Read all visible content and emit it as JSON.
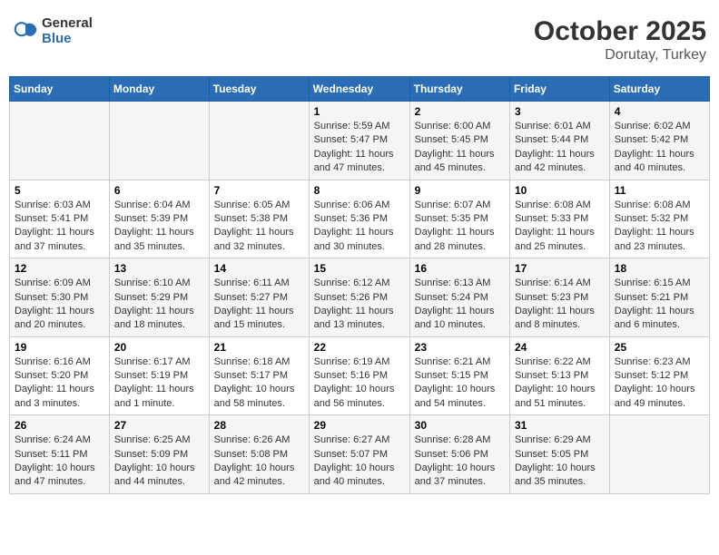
{
  "header": {
    "logo_general": "General",
    "logo_blue": "Blue",
    "month": "October 2025",
    "location": "Dorutay, Turkey"
  },
  "weekdays": [
    "Sunday",
    "Monday",
    "Tuesday",
    "Wednesday",
    "Thursday",
    "Friday",
    "Saturday"
  ],
  "weeks": [
    [
      {
        "day": "",
        "info": ""
      },
      {
        "day": "",
        "info": ""
      },
      {
        "day": "",
        "info": ""
      },
      {
        "day": "1",
        "info": "Sunrise: 5:59 AM\nSunset: 5:47 PM\nDaylight: 11 hours and 47 minutes."
      },
      {
        "day": "2",
        "info": "Sunrise: 6:00 AM\nSunset: 5:45 PM\nDaylight: 11 hours and 45 minutes."
      },
      {
        "day": "3",
        "info": "Sunrise: 6:01 AM\nSunset: 5:44 PM\nDaylight: 11 hours and 42 minutes."
      },
      {
        "day": "4",
        "info": "Sunrise: 6:02 AM\nSunset: 5:42 PM\nDaylight: 11 hours and 40 minutes."
      }
    ],
    [
      {
        "day": "5",
        "info": "Sunrise: 6:03 AM\nSunset: 5:41 PM\nDaylight: 11 hours and 37 minutes."
      },
      {
        "day": "6",
        "info": "Sunrise: 6:04 AM\nSunset: 5:39 PM\nDaylight: 11 hours and 35 minutes."
      },
      {
        "day": "7",
        "info": "Sunrise: 6:05 AM\nSunset: 5:38 PM\nDaylight: 11 hours and 32 minutes."
      },
      {
        "day": "8",
        "info": "Sunrise: 6:06 AM\nSunset: 5:36 PM\nDaylight: 11 hours and 30 minutes."
      },
      {
        "day": "9",
        "info": "Sunrise: 6:07 AM\nSunset: 5:35 PM\nDaylight: 11 hours and 28 minutes."
      },
      {
        "day": "10",
        "info": "Sunrise: 6:08 AM\nSunset: 5:33 PM\nDaylight: 11 hours and 25 minutes."
      },
      {
        "day": "11",
        "info": "Sunrise: 6:08 AM\nSunset: 5:32 PM\nDaylight: 11 hours and 23 minutes."
      }
    ],
    [
      {
        "day": "12",
        "info": "Sunrise: 6:09 AM\nSunset: 5:30 PM\nDaylight: 11 hours and 20 minutes."
      },
      {
        "day": "13",
        "info": "Sunrise: 6:10 AM\nSunset: 5:29 PM\nDaylight: 11 hours and 18 minutes."
      },
      {
        "day": "14",
        "info": "Sunrise: 6:11 AM\nSunset: 5:27 PM\nDaylight: 11 hours and 15 minutes."
      },
      {
        "day": "15",
        "info": "Sunrise: 6:12 AM\nSunset: 5:26 PM\nDaylight: 11 hours and 13 minutes."
      },
      {
        "day": "16",
        "info": "Sunrise: 6:13 AM\nSunset: 5:24 PM\nDaylight: 11 hours and 10 minutes."
      },
      {
        "day": "17",
        "info": "Sunrise: 6:14 AM\nSunset: 5:23 PM\nDaylight: 11 hours and 8 minutes."
      },
      {
        "day": "18",
        "info": "Sunrise: 6:15 AM\nSunset: 5:21 PM\nDaylight: 11 hours and 6 minutes."
      }
    ],
    [
      {
        "day": "19",
        "info": "Sunrise: 6:16 AM\nSunset: 5:20 PM\nDaylight: 11 hours and 3 minutes."
      },
      {
        "day": "20",
        "info": "Sunrise: 6:17 AM\nSunset: 5:19 PM\nDaylight: 11 hours and 1 minute."
      },
      {
        "day": "21",
        "info": "Sunrise: 6:18 AM\nSunset: 5:17 PM\nDaylight: 10 hours and 58 minutes."
      },
      {
        "day": "22",
        "info": "Sunrise: 6:19 AM\nSunset: 5:16 PM\nDaylight: 10 hours and 56 minutes."
      },
      {
        "day": "23",
        "info": "Sunrise: 6:21 AM\nSunset: 5:15 PM\nDaylight: 10 hours and 54 minutes."
      },
      {
        "day": "24",
        "info": "Sunrise: 6:22 AM\nSunset: 5:13 PM\nDaylight: 10 hours and 51 minutes."
      },
      {
        "day": "25",
        "info": "Sunrise: 6:23 AM\nSunset: 5:12 PM\nDaylight: 10 hours and 49 minutes."
      }
    ],
    [
      {
        "day": "26",
        "info": "Sunrise: 6:24 AM\nSunset: 5:11 PM\nDaylight: 10 hours and 47 minutes."
      },
      {
        "day": "27",
        "info": "Sunrise: 6:25 AM\nSunset: 5:09 PM\nDaylight: 10 hours and 44 minutes."
      },
      {
        "day": "28",
        "info": "Sunrise: 6:26 AM\nSunset: 5:08 PM\nDaylight: 10 hours and 42 minutes."
      },
      {
        "day": "29",
        "info": "Sunrise: 6:27 AM\nSunset: 5:07 PM\nDaylight: 10 hours and 40 minutes."
      },
      {
        "day": "30",
        "info": "Sunrise: 6:28 AM\nSunset: 5:06 PM\nDaylight: 10 hours and 37 minutes."
      },
      {
        "day": "31",
        "info": "Sunrise: 6:29 AM\nSunset: 5:05 PM\nDaylight: 10 hours and 35 minutes."
      },
      {
        "day": "",
        "info": ""
      }
    ]
  ]
}
